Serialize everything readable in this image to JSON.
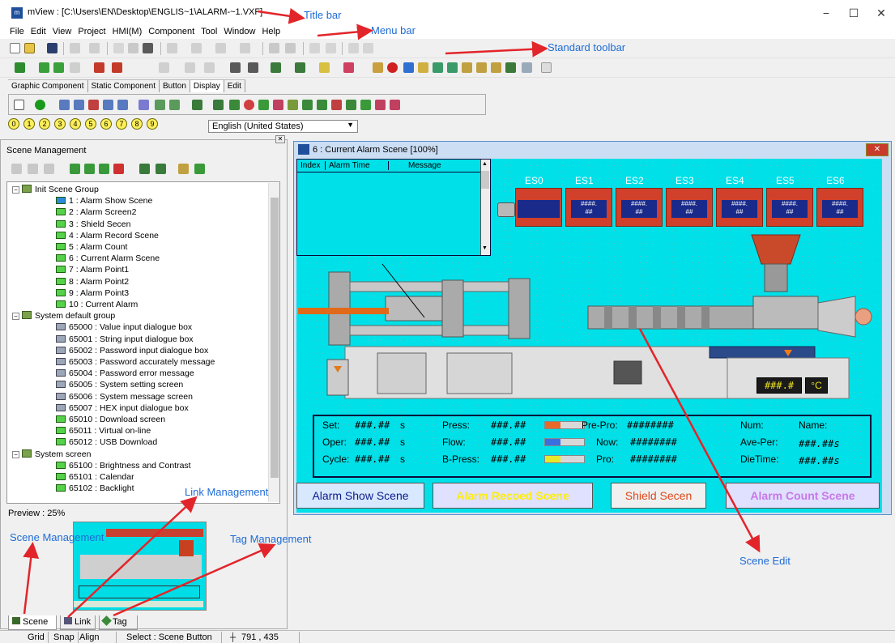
{
  "window": {
    "app_label": "m",
    "title": "mView : [C:\\Users\\EN\\Desktop\\ENGLIS~1\\ALARM-~1.VXF]",
    "minimize": "−",
    "maximize": "☐",
    "close": "✕"
  },
  "menu": [
    "File",
    "Edit",
    "View",
    "Project",
    "HMI(M)",
    "Component",
    "Tool",
    "Window",
    "Help"
  ],
  "component_tabs": [
    "Graphic Component",
    "Static Component",
    "Button",
    "Display",
    "Edit"
  ],
  "numbers": [
    "0",
    "1",
    "2",
    "3",
    "4",
    "5",
    "6",
    "7",
    "8",
    "9"
  ],
  "language": "English (United States)",
  "annotations": {
    "title_bar": "Title bar",
    "menu_bar": "Menu bar",
    "standard_toolbar": "Standard toolbar",
    "link_management": "Link Management",
    "scene_management": "Scene Management",
    "tag_management": "Tag Management",
    "scene_edit": "Scene Edit"
  },
  "left": {
    "panel_title": "Scene Management",
    "preview_label": "Preview : 25%",
    "tabs": [
      "Scene",
      "Link",
      "Tag"
    ],
    "tree": [
      {
        "depth": 0,
        "type": "group",
        "label": "Init Scene Group"
      },
      {
        "depth": 1,
        "type": "scene_first",
        "label": "1 : Alarm Show Scene"
      },
      {
        "depth": 1,
        "type": "scene",
        "label": "2 : Alarm Screen2"
      },
      {
        "depth": 1,
        "type": "scene",
        "label": "3 : Shield Secen"
      },
      {
        "depth": 1,
        "type": "scene",
        "label": "4 : Alarm Record Scene"
      },
      {
        "depth": 1,
        "type": "scene",
        "label": "5 : Alarm Count"
      },
      {
        "depth": 1,
        "type": "scene",
        "label": "6 : Current Alarm Scene"
      },
      {
        "depth": 1,
        "type": "scene",
        "label": "7 : Alarm Point1"
      },
      {
        "depth": 1,
        "type": "scene",
        "label": "8 : Alarm Point2"
      },
      {
        "depth": 1,
        "type": "scene",
        "label": "9 : Alarm Point3"
      },
      {
        "depth": 1,
        "type": "scene",
        "label": "10 : Current Alarm"
      },
      {
        "depth": 0,
        "type": "group",
        "label": "System default group"
      },
      {
        "depth": 1,
        "type": "sys",
        "label": "65000 : Value input dialogue box"
      },
      {
        "depth": 1,
        "type": "sys",
        "label": "65001 : String input dialogue box"
      },
      {
        "depth": 1,
        "type": "sys",
        "label": "65002 : Password input dialogue box"
      },
      {
        "depth": 1,
        "type": "sys",
        "label": "65003 : Password accurately message"
      },
      {
        "depth": 1,
        "type": "sys",
        "label": "65004 : Password error message"
      },
      {
        "depth": 1,
        "type": "sys",
        "label": "65005 : System setting screen"
      },
      {
        "depth": 1,
        "type": "sys",
        "label": "65006 : System message screen"
      },
      {
        "depth": 1,
        "type": "sys",
        "label": "65007 : HEX input dialogue box"
      },
      {
        "depth": 1,
        "type": "scene",
        "label": "65010 : Download screen"
      },
      {
        "depth": 1,
        "type": "scene",
        "label": "65011 : Virtual on-line"
      },
      {
        "depth": 1,
        "type": "scene",
        "label": "65012 : USB Download"
      },
      {
        "depth": 0,
        "type": "group",
        "label": "System screen"
      },
      {
        "depth": 1,
        "type": "scene",
        "label": "65100 : Brightness and Contrast"
      },
      {
        "depth": 1,
        "type": "scene",
        "label": "65101 : Calendar"
      },
      {
        "depth": 1,
        "type": "scene",
        "label": "65102 : Backlight"
      }
    ]
  },
  "scene": {
    "title": "6 : Current Alarm Scene [100%]",
    "alarm_table_headers": [
      "Index",
      "Alarm Time",
      "Message"
    ],
    "es_labels": [
      "ES0",
      "ES1",
      "ES2",
      "ES3",
      "ES4",
      "ES5",
      "ES6"
    ],
    "es_value": "####.",
    "es_sub": "##",
    "temp_value": "###.#",
    "temp_unit": "°C",
    "rows": [
      {
        "a_label": "Set:",
        "a_val": "###.##",
        "a_unit": "s",
        "b_label": "Press:",
        "b_val": "###.##",
        "bar_color": "#e86a2a",
        "c_label": "Pre-Pro:",
        "c_val": "########",
        "d_label": "Num:",
        "e_label": "Name:"
      },
      {
        "a_label": "Oper:",
        "a_val": "###.##",
        "a_unit": "s",
        "b_label": "Flow:",
        "b_val": "###.##",
        "bar_color": "#3a6fe0",
        "c_label": "Now:",
        "c_val": "########",
        "d_label": "Ave-Per:",
        "e_label": "###.##s"
      },
      {
        "a_label": "Cycle:",
        "a_val": "###.##",
        "a_unit": "s",
        "b_label": "B-Press:",
        "b_val": "###.##",
        "bar_color": "#e8e82a",
        "c_label": "Pro:",
        "c_val": "########",
        "d_label": "DieTime:",
        "e_label": "###.##s"
      }
    ],
    "buttons": [
      {
        "label": "Alarm Show Scene",
        "color": "#0b1a8a"
      },
      {
        "label": "Alarm Recoed Scene",
        "color": "#ffee00"
      },
      {
        "label": "Shield Secen",
        "color": "#e0481a"
      },
      {
        "label": "Alarm Count Scene",
        "color": "#c878e8"
      }
    ]
  },
  "status": {
    "grid": "Grid",
    "snap": "Snap",
    "align": "Align",
    "select": "Select : Scene Button",
    "coords": "791 , 435"
  }
}
